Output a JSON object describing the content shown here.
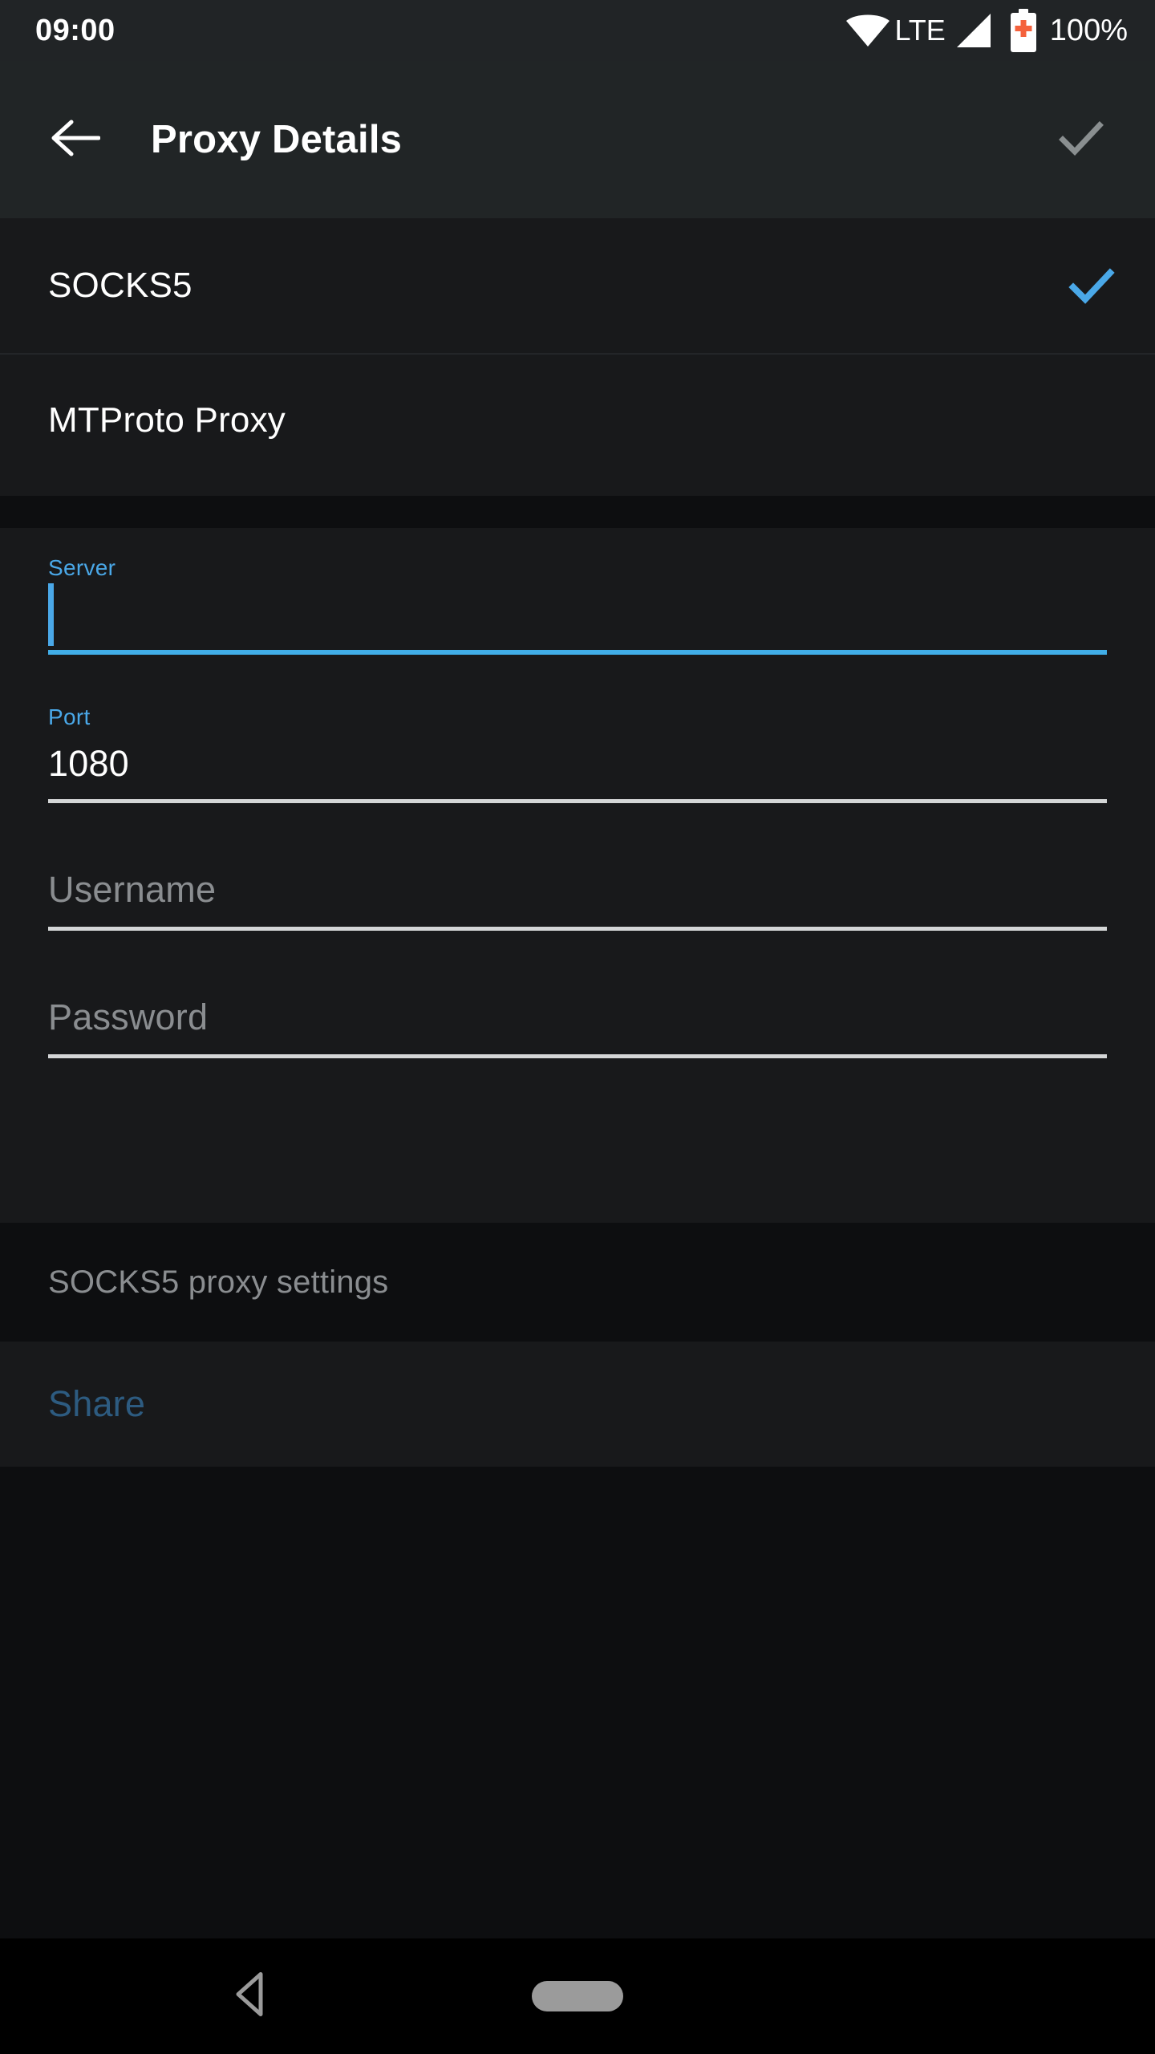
{
  "status_bar": {
    "time": "09:00",
    "network_type": "LTE",
    "battery_percent": "100%",
    "icons": [
      "wifi-icon",
      "signal-icon",
      "battery-charging-icon"
    ]
  },
  "toolbar": {
    "back_label": "back-arrow",
    "title": "Proxy Details",
    "done_label": "done-check",
    "done_enabled": false
  },
  "proxy_type": {
    "options": [
      {
        "label": "SOCKS5",
        "selected": true
      },
      {
        "label": "MTProto Proxy",
        "selected": false
      }
    ]
  },
  "form": {
    "server": {
      "label": "Server",
      "value": "",
      "placeholder": "Server",
      "focused": true
    },
    "port": {
      "label": "Port",
      "value": "1080",
      "placeholder": "Port",
      "focused": false
    },
    "username": {
      "label": "Username",
      "value": "",
      "placeholder": "Username",
      "focused": false
    },
    "password": {
      "label": "Password",
      "value": "",
      "placeholder": "Password",
      "focused": false
    }
  },
  "footer": {
    "note": "SOCKS5 proxy settings",
    "share_label": "Share",
    "share_enabled": false
  },
  "nav_bar": {
    "back": "nav-back-triangle",
    "home": "nav-home-pill"
  },
  "colors": {
    "accent_blue": "#41aee8",
    "check_blue": "#4aa8e8",
    "disabled_blue": "#2d5b80",
    "toolbar_bg": "#212526",
    "content_bg": "#18191b",
    "section_gap_bg": "#0d0e10",
    "muted_text": "#8a8d90",
    "battery_accent": "#f4613c"
  }
}
